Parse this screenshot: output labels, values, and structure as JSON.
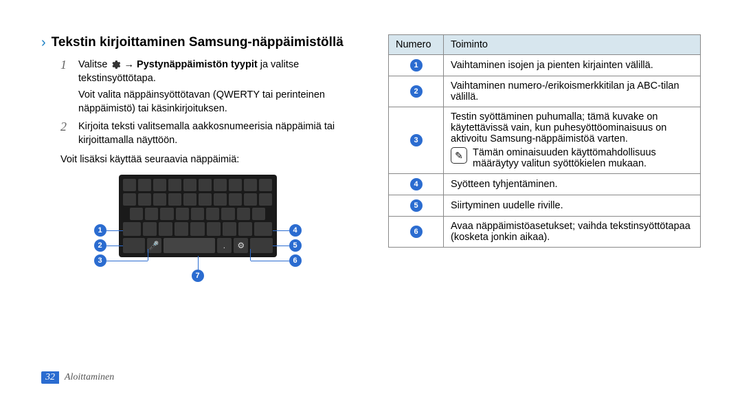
{
  "heading": "Tekstin kirjoittaminen Samsung-näppäimistöllä",
  "steps": [
    {
      "num": "1",
      "pre": "Valitse ",
      "bold": "Pystynäppäimistön tyypit",
      "post": " ja valitse tekstinsyöttötapa.",
      "sub": "Voit valita näppäinsyöttötavan (QWERTY tai perinteinen näppäimistö) tai käsinkirjoituksen."
    },
    {
      "num": "2",
      "text": "Kirjoita teksti valitsemalla aakkosnumeerisia näppäimiä tai kirjoittamalla näyttöön."
    }
  ],
  "plain": "Voit lisäksi käyttää seuraavia näppäimiä:",
  "table": {
    "head": {
      "c1": "Numero",
      "c2": "Toiminto"
    },
    "rows": [
      {
        "n": "1",
        "t": "Vaihtaminen isojen ja pienten kirjainten välillä."
      },
      {
        "n": "2",
        "t": "Vaihtaminen numero-/erikoismerkkitilan ja ABC-tilan välillä."
      },
      {
        "n": "3",
        "t": "Testin syöttäminen puhumalla; tämä kuvake on käytettävissä vain, kun puhesyöttöominaisuus on aktivoitu Samsung-näppäimistöä varten.",
        "note": "Tämän ominaisuuden käyttömahdollisuus määräytyy valitun syöttökielen mukaan."
      },
      {
        "n": "4",
        "t": "Syötteen tyhjentäminen."
      },
      {
        "n": "5",
        "t": "Siirtyminen uudelle riville."
      },
      {
        "n": "6",
        "t": "Avaa näppäimistöasetukset; vaihda tekstinsyöttötapaa (kosketa jonkin aikaa)."
      }
    ]
  },
  "callouts": {
    "c1": "1",
    "c2": "2",
    "c3": "3",
    "c4": "4",
    "c5": "5",
    "c6": "6",
    "c7": "7"
  },
  "arrow_glyph": "→",
  "footer": {
    "page": "32",
    "section": "Aloittaminen"
  }
}
